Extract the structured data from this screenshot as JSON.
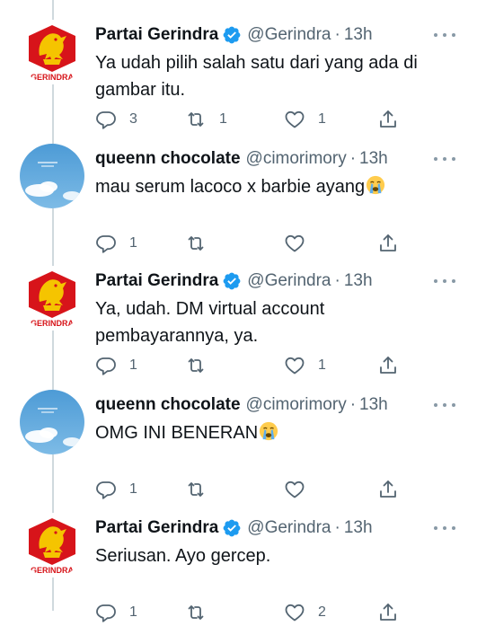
{
  "tweets": [
    {
      "name": "Partai Gerindra",
      "verified": true,
      "handle": "@Gerindra",
      "separator": "·",
      "time": "13h",
      "text": "Ya udah pilih salah satu dari yang ada di gambar itu.",
      "emoji": "",
      "avatar": "gerindra-logo",
      "avatar_text": "GERINDRA",
      "replies": "3",
      "retweets": "1",
      "likes": "1"
    },
    {
      "name": "queenn chocolate",
      "verified": false,
      "handle": "@cimorimory",
      "separator": "·",
      "time": "13h",
      "text": "mau serum lacoco x barbie ayang",
      "emoji": "loudly-crying-face",
      "avatar": "sky-clouds",
      "avatar_text": "",
      "replies": "1",
      "retweets": "",
      "likes": ""
    },
    {
      "name": "Partai Gerindra",
      "verified": true,
      "handle": "@Gerindra",
      "separator": "·",
      "time": "13h",
      "text": "Ya, udah. DM virtual account pembayarannya, ya.",
      "emoji": "",
      "avatar": "gerindra-logo",
      "avatar_text": "GERINDRA",
      "replies": "1",
      "retweets": "",
      "likes": "1"
    },
    {
      "name": "queenn chocolate",
      "verified": false,
      "handle": "@cimorimory",
      "separator": "·",
      "time": "13h",
      "text": "OMG INI BENERAN",
      "emoji": "loudly-crying-face",
      "avatar": "sky-clouds",
      "avatar_text": "",
      "replies": "1",
      "retweets": "",
      "likes": ""
    },
    {
      "name": "Partai Gerindra",
      "verified": true,
      "handle": "@Gerindra",
      "separator": "·",
      "time": "13h",
      "text": "Seriusan. Ayo gercep.",
      "emoji": "",
      "avatar": "gerindra-logo",
      "avatar_text": "GERINDRA",
      "replies": "1",
      "retweets": "",
      "likes": "2"
    }
  ],
  "icons": {
    "reply": "reply-icon",
    "retweet": "retweet-icon",
    "like": "heart-icon",
    "share": "share-icon",
    "more": "more-icon",
    "verified": "verified-badge-icon"
  },
  "colors": {
    "text": "#0f1419",
    "secondary": "#536471",
    "verified": "#1d9bf0",
    "thread_line": "#cfd9de",
    "gerindra_red": "#d7141a",
    "gerindra_gold": "#f5c400",
    "sky_blue": "#5aa5d8"
  }
}
